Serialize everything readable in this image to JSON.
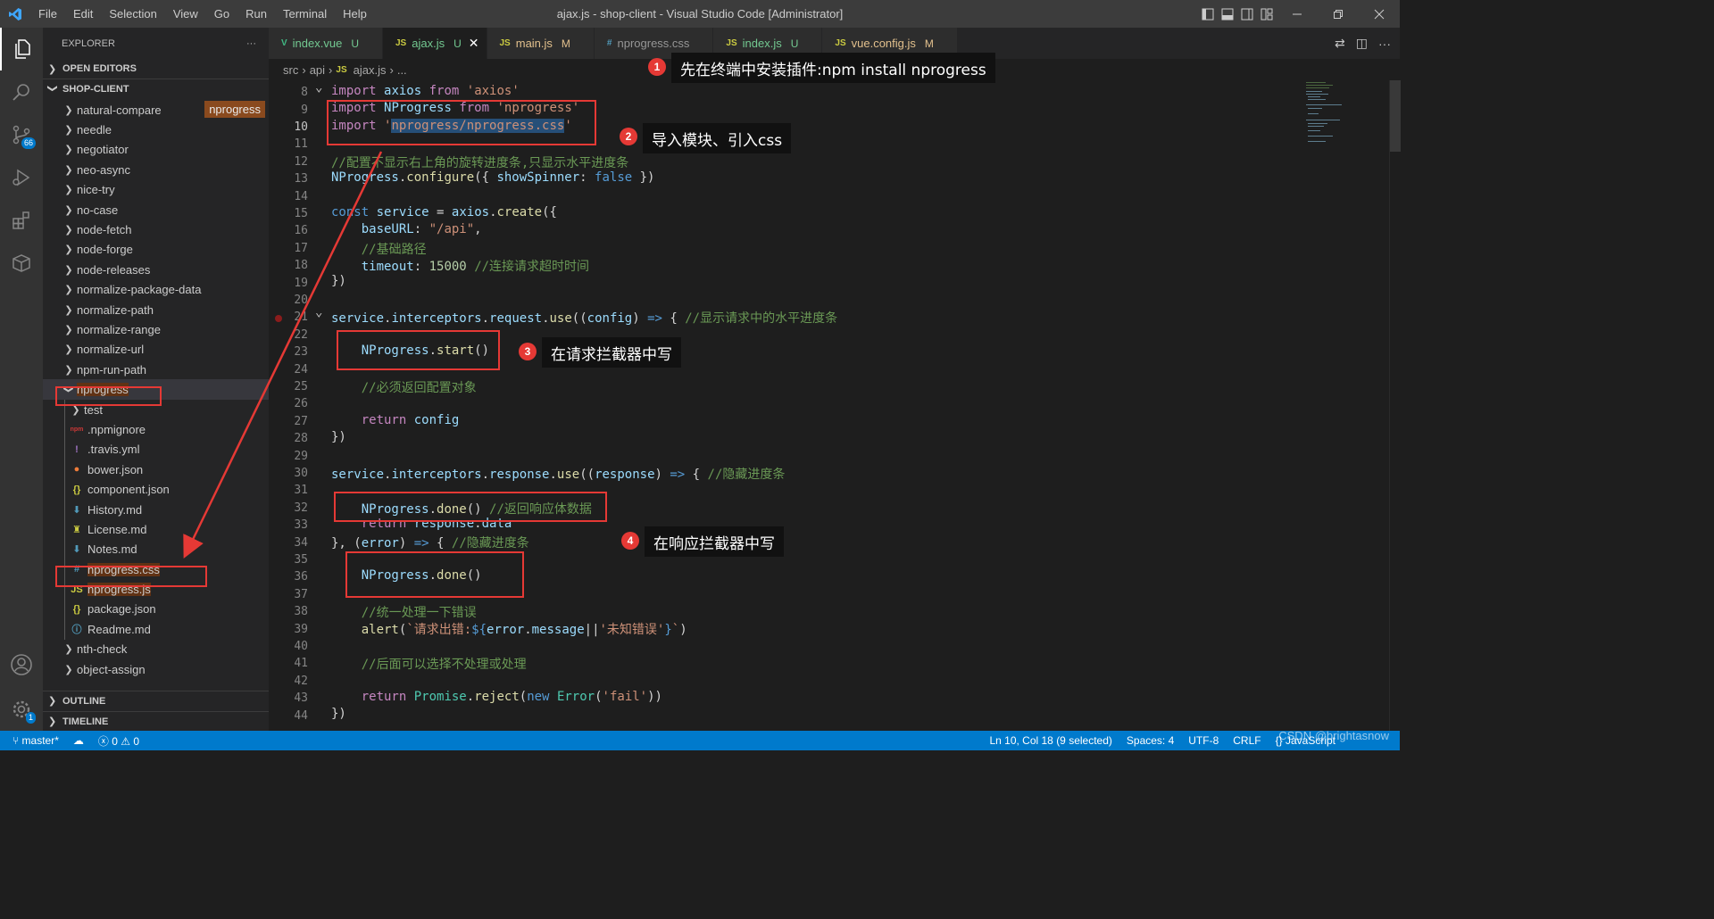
{
  "titlebar": {
    "menu": [
      "File",
      "Edit",
      "Selection",
      "View",
      "Go",
      "Run",
      "Terminal",
      "Help"
    ],
    "title": "ajax.js - shop-client - Visual Studio Code [Administrator]"
  },
  "activity": {
    "scm_badge": "66",
    "settings_badge": "1"
  },
  "sidebar": {
    "header": "EXPLORER",
    "more": "···",
    "open_editors": "OPEN EDITORS",
    "project": "SHOP-CLIENT",
    "tag": "nprogress",
    "items": [
      {
        "label": "natural-compare",
        "type": "folder"
      },
      {
        "label": "needle",
        "type": "folder"
      },
      {
        "label": "negotiator",
        "type": "folder"
      },
      {
        "label": "neo-async",
        "type": "folder"
      },
      {
        "label": "nice-try",
        "type": "folder"
      },
      {
        "label": "no-case",
        "type": "folder"
      },
      {
        "label": "node-fetch",
        "type": "folder"
      },
      {
        "label": "node-forge",
        "type": "folder"
      },
      {
        "label": "node-releases",
        "type": "folder"
      },
      {
        "label": "normalize-package-data",
        "type": "folder"
      },
      {
        "label": "normalize-path",
        "type": "folder"
      },
      {
        "label": "normalize-range",
        "type": "folder"
      },
      {
        "label": "normalize-url",
        "type": "folder"
      },
      {
        "label": "npm-run-path",
        "type": "folder"
      },
      {
        "label": "nprogress",
        "type": "open-folder"
      },
      {
        "label": "test",
        "type": "subfolder"
      },
      {
        "label": ".npmignore",
        "type": "file",
        "icon": "npm",
        "color": "#cb3837"
      },
      {
        "label": ".travis.yml",
        "type": "file",
        "icon": "!",
        "color": "#a074c4"
      },
      {
        "label": "bower.json",
        "type": "file",
        "icon": "●",
        "color": "#ef7c3a"
      },
      {
        "label": "component.json",
        "type": "file",
        "icon": "{}",
        "color": "#cbcb41"
      },
      {
        "label": "History.md",
        "type": "file",
        "icon": "⬇",
        "color": "#519aba"
      },
      {
        "label": "License.md",
        "type": "file",
        "icon": "♜",
        "color": "#cbcb41"
      },
      {
        "label": "Notes.md",
        "type": "file",
        "icon": "⬇",
        "color": "#519aba"
      },
      {
        "label": "nprogress.css",
        "type": "file",
        "icon": "#",
        "color": "#519aba"
      },
      {
        "label": "nprogress.js",
        "type": "file",
        "icon": "JS",
        "color": "#cbcb41"
      },
      {
        "label": "package.json",
        "type": "file",
        "icon": "{}",
        "color": "#cbcb41"
      },
      {
        "label": "Readme.md",
        "type": "file",
        "icon": "ⓘ",
        "color": "#519aba"
      },
      {
        "label": "nth-check",
        "type": "folder"
      },
      {
        "label": "object-assign",
        "type": "folder"
      }
    ],
    "outline": "OUTLINE",
    "timeline": "TIMELINE"
  },
  "tabs": [
    {
      "icon": "V",
      "icon_color": "#41b883",
      "label": "index.vue",
      "status": "U",
      "status_color": "#73c991",
      "label_color": "#73c991"
    },
    {
      "icon": "JS",
      "icon_color": "#cbcb41",
      "label": "ajax.js",
      "status": "U",
      "status_color": "#73c991",
      "label_color": "#73c991",
      "active": true
    },
    {
      "icon": "JS",
      "icon_color": "#cbcb41",
      "label": "main.js",
      "status": "M",
      "status_color": "#e2c08d",
      "label_color": "#e2c08d"
    },
    {
      "icon": "#",
      "icon_color": "#519aba",
      "label": "nprogress.css",
      "status": "",
      "status_color": "#969696",
      "label_color": "#969696"
    },
    {
      "icon": "JS",
      "icon_color": "#cbcb41",
      "label": "index.js",
      "status": "U",
      "status_color": "#73c991",
      "label_color": "#73c991"
    },
    {
      "icon": "JS",
      "icon_color": "#cbcb41",
      "label": "vue.config.js",
      "status": "M",
      "status_color": "#e2c08d",
      "label_color": "#e2c08d"
    }
  ],
  "breadcrumbs": [
    "src",
    "api",
    "ajax.js",
    "..."
  ],
  "code": {
    "line_numbers": [
      "8",
      "9",
      "10",
      "11",
      "12",
      "13",
      "14",
      "15",
      "16",
      "17",
      "18",
      "19",
      "20",
      "21",
      "22",
      "23",
      "24",
      "25",
      "26",
      "27",
      "28",
      "29",
      "30",
      "31",
      "32",
      "33",
      "34",
      "35",
      "36",
      "37",
      "38",
      "39",
      "40",
      "41",
      "42",
      "43",
      "44"
    ],
    "current_line": "10"
  },
  "annotations": [
    {
      "n": "1",
      "text": "先在终端中安装插件:npm install nprogress"
    },
    {
      "n": "2",
      "text": "导入模块、引入css"
    },
    {
      "n": "3",
      "text": "在请求拦截器中写"
    },
    {
      "n": "4",
      "text": "在响应拦截器中写"
    }
  ],
  "status": {
    "branch": "master*",
    "errors": "0",
    "warnings": "0",
    "position": "Ln 10, Col 18 (9 selected)",
    "spaces": "Spaces: 4",
    "encoding": "UTF-8",
    "eol": "CRLF",
    "language": "JavaScript",
    "watermark": "CSDN @brightasnow"
  },
  "colors": {
    "accent": "#007acc",
    "annotation_red": "#e53935"
  }
}
